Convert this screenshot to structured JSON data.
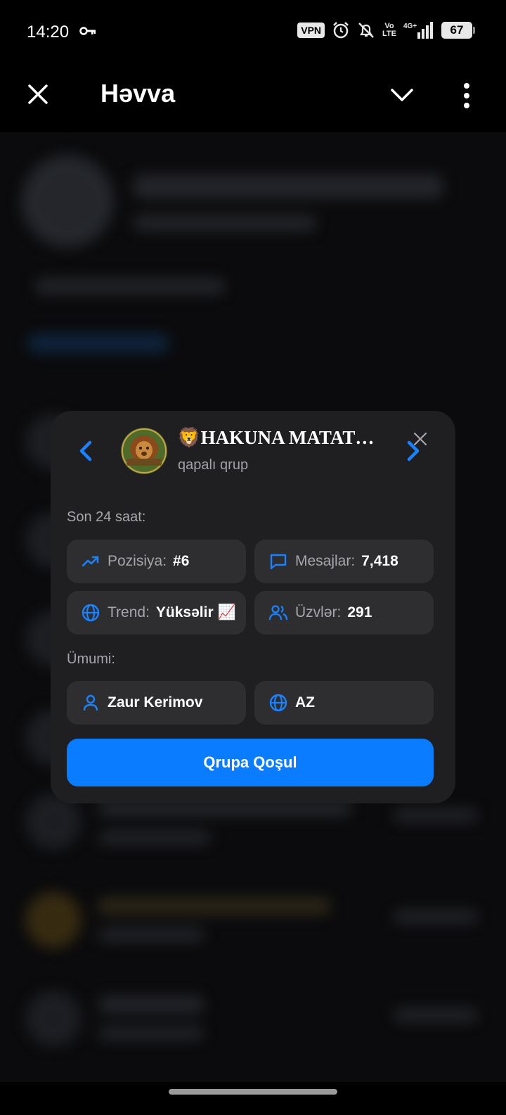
{
  "status_bar": {
    "time": "14:20",
    "vpn": "VPN",
    "volte_top": "Vo",
    "volte_bottom": "LTE",
    "network": "4G+",
    "battery": "67"
  },
  "header": {
    "title": "Həvva"
  },
  "group_card": {
    "title": "🦁HAKUNA MATAT…",
    "subtitle": "qapalı qrup",
    "last24_label": "Son 24 saat:",
    "stats": {
      "position": {
        "label": "Pozisiya:",
        "value": "#6"
      },
      "messages": {
        "label": "Mesajlar:",
        "value": "7,418"
      },
      "trend": {
        "label": "Trend:",
        "value": "Yüksəlir 📈"
      },
      "members": {
        "label": "Üzvlər:",
        "value": "291"
      }
    },
    "general_label": "Ümumi:",
    "owner": "Zaur Kerimov",
    "language": "AZ",
    "join_button": "Qrupa Qoşul"
  },
  "colors": {
    "accent": "#0a7cff",
    "card_bg": "#1f1f22",
    "tile_bg": "#2e2e31",
    "muted_text": "#a6a6ac"
  },
  "icons": {
    "status": [
      "key-icon",
      "alarm-icon",
      "bell-off-icon",
      "signal-icon"
    ],
    "header": [
      "close-icon",
      "check-icon",
      "more-vertical-icon"
    ],
    "card": [
      "chevron-left-icon",
      "chevron-right-icon",
      "close-icon",
      "trending-up-icon",
      "message-icon",
      "globe-icon",
      "users-icon",
      "user-icon"
    ]
  }
}
